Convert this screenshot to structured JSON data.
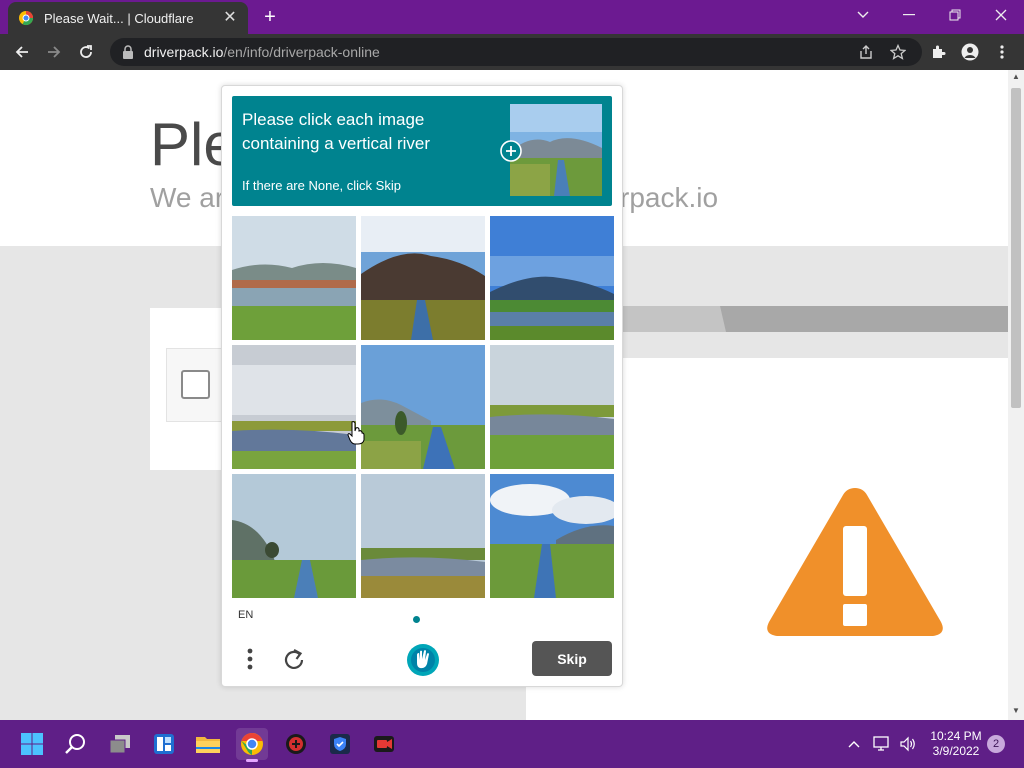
{
  "browser": {
    "tab_title": "Please Wait... | Cloudflare",
    "url_domain": "driverpack.io",
    "url_path": "/en/info/driverpack-online"
  },
  "page": {
    "heading_partial": "Ple",
    "subtitle_left_partial": "We ar",
    "subtitle_right_partial": "rpack.io"
  },
  "captcha": {
    "prompt": "Please click each image containing a vertical river",
    "sub_prompt": "If there are None, click Skip",
    "language": "EN",
    "skip_label": "Skip",
    "accent_color": "#00838f",
    "images": [
      {
        "scene": "lake-mountains"
      },
      {
        "scene": "mountain-river"
      },
      {
        "scene": "lake-blue-sky"
      },
      {
        "scene": "cloudy-pond"
      },
      {
        "scene": "river-tree"
      },
      {
        "scene": "overcast-lake"
      },
      {
        "scene": "tree-river"
      },
      {
        "scene": "grey-pond"
      },
      {
        "scene": "cloud-river"
      }
    ]
  },
  "taskbar": {
    "time": "10:24 PM",
    "date": "3/9/2022",
    "notification_count": "2"
  }
}
